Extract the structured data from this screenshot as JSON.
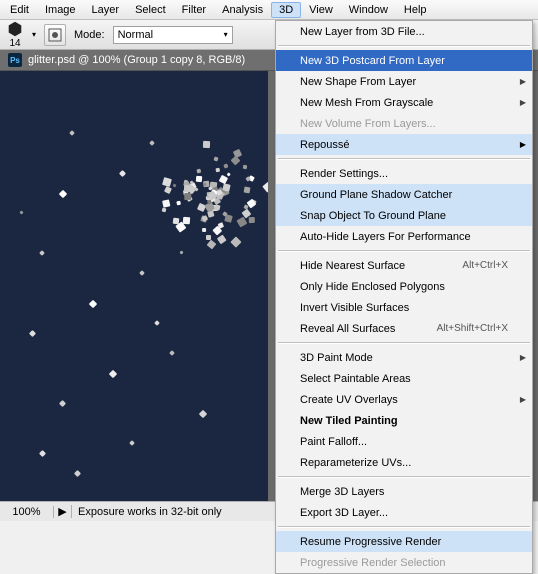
{
  "menubar": {
    "items": [
      "Edit",
      "Image",
      "Layer",
      "Select",
      "Filter",
      "Analysis",
      "3D",
      "View",
      "Window",
      "Help"
    ],
    "open_index": 6
  },
  "toolbar": {
    "tool_number": "14",
    "mode_label": "Mode:",
    "mode_value": "Normal"
  },
  "document": {
    "tab_title": "glitter.psd @ 100% (Group 1 copy 8, RGB/8)",
    "ps_badge": "Ps",
    "close_glyph": "×"
  },
  "dropdown": {
    "groups": [
      [
        {
          "label": "New Layer from 3D File...",
          "state": "normal"
        }
      ],
      [
        {
          "label": "New 3D Postcard From Layer",
          "state": "highlight"
        },
        {
          "label": "New Shape From Layer",
          "state": "normal",
          "submenu": true
        },
        {
          "label": "New Mesh From Grayscale",
          "state": "normal",
          "submenu": true
        },
        {
          "label": "New Volume From Layers...",
          "state": "disabled"
        },
        {
          "label": "Repoussé",
          "state": "active",
          "submenu": true
        }
      ],
      [
        {
          "label": "Render Settings...",
          "state": "normal"
        },
        {
          "label": "Ground Plane Shadow Catcher",
          "state": "active"
        },
        {
          "label": "Snap Object To Ground Plane",
          "state": "active"
        },
        {
          "label": "Auto-Hide Layers For Performance",
          "state": "normal"
        }
      ],
      [
        {
          "label": "Hide Nearest Surface",
          "state": "normal",
          "shortcut": "Alt+Ctrl+X"
        },
        {
          "label": "Only Hide Enclosed Polygons",
          "state": "normal"
        },
        {
          "label": "Invert Visible Surfaces",
          "state": "normal"
        },
        {
          "label": "Reveal All Surfaces",
          "state": "normal",
          "shortcut": "Alt+Shift+Ctrl+X"
        }
      ],
      [
        {
          "label": "3D Paint Mode",
          "state": "normal",
          "submenu": true
        },
        {
          "label": "Select Paintable Areas",
          "state": "normal"
        },
        {
          "label": "Create UV Overlays",
          "state": "normal",
          "submenu": true
        },
        {
          "label": "New Tiled Painting",
          "state": "normal",
          "bold": true
        },
        {
          "label": "Paint Falloff...",
          "state": "normal"
        },
        {
          "label": "Reparameterize UVs...",
          "state": "normal"
        }
      ],
      [
        {
          "label": "Merge 3D Layers",
          "state": "normal"
        },
        {
          "label": "Export 3D Layer...",
          "state": "normal"
        }
      ],
      [
        {
          "label": "Resume Progressive Render",
          "state": "active"
        },
        {
          "label": "Progressive Render Selection",
          "state": "disabled"
        }
      ]
    ]
  },
  "status": {
    "zoom": "100%",
    "play_glyph": "▶",
    "message": "Exposure works in 32-bit only",
    "arrow_glyph": "▶"
  },
  "colors": {
    "canvas_bg": "#1b2640",
    "menu_highlight": "#316ac5",
    "menu_active": "#cde2f7"
  }
}
